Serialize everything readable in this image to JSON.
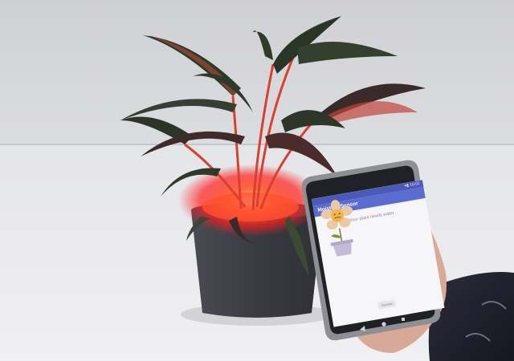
{
  "phone": {
    "status_time": "16:02",
    "app_title": "Moisture Sensor",
    "message": "Your plant needs water",
    "button_label": "Dismiss"
  },
  "colors": {
    "background_wall": "#d8d9dd",
    "table_surface": "#eaebee",
    "pot": "#3f4047",
    "glow": "#ff2a2a",
    "leaf_dark": "#2f3b2a",
    "app_bar": "#5b6cd1"
  },
  "icons": {
    "flower": "flower-illustration",
    "signal": "signal-icon",
    "battery": "battery-icon"
  }
}
